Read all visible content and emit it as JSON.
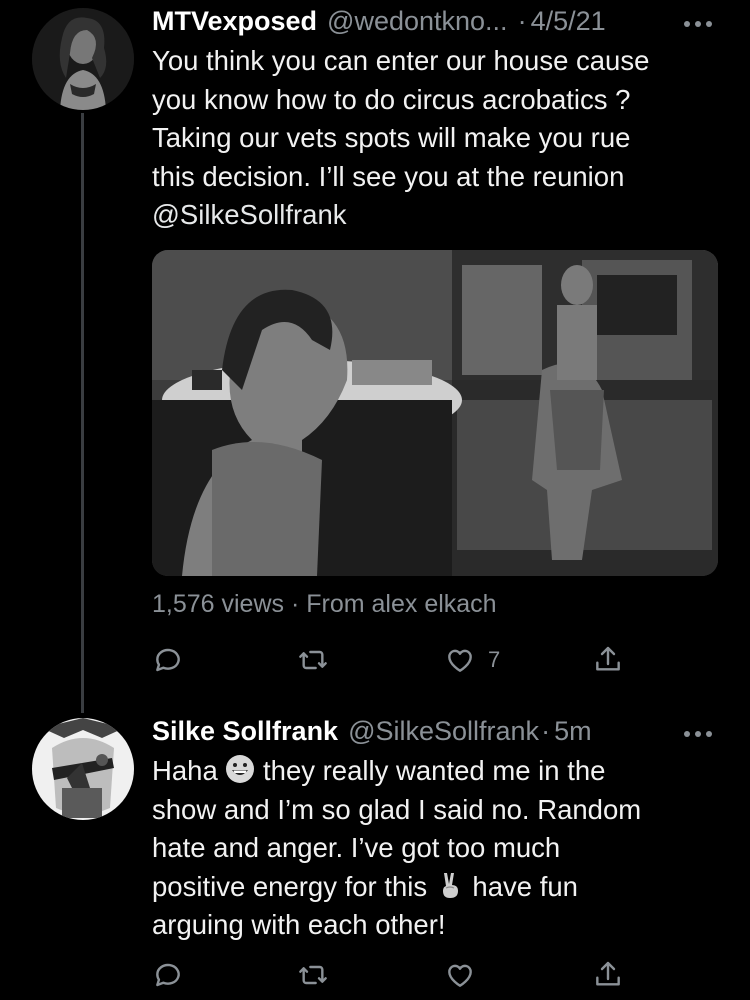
{
  "tweets": [
    {
      "name": "MTVexposed",
      "handle": "@wedontkno...",
      "dot": "·",
      "time": "4/5/21",
      "lines": [
        "You think you can enter our house cause",
        "you know how to do circus acrobatics ?",
        "Taking our vets spots will make you rue",
        "this decision. I’ll see you at the reunion"
      ],
      "mention": "@SilkeSollfrank",
      "meta": "1,576 views · From alex elkach",
      "like_count": "7"
    },
    {
      "name": "Silke Sollfrank",
      "handle": "@SilkeSollfrank",
      "dot": "·",
      "time": "5m",
      "line1_a": "Haha ",
      "line1_b": " they really wanted me in the",
      "line2": "show and I’m so glad I said no. Random",
      "line3": "hate and anger. I’ve got too much",
      "line4_a": "positive energy for this ",
      "line4_b": " have fun",
      "line5": "arguing with each other!"
    }
  ],
  "icons": [
    "reply-icon",
    "retweet-icon",
    "like-icon",
    "share-icon",
    "more-icon"
  ],
  "colors": {
    "background": "#000000",
    "text": "#e7e9ea",
    "secondary": "#8b9197",
    "thread": "#3a3d41"
  }
}
